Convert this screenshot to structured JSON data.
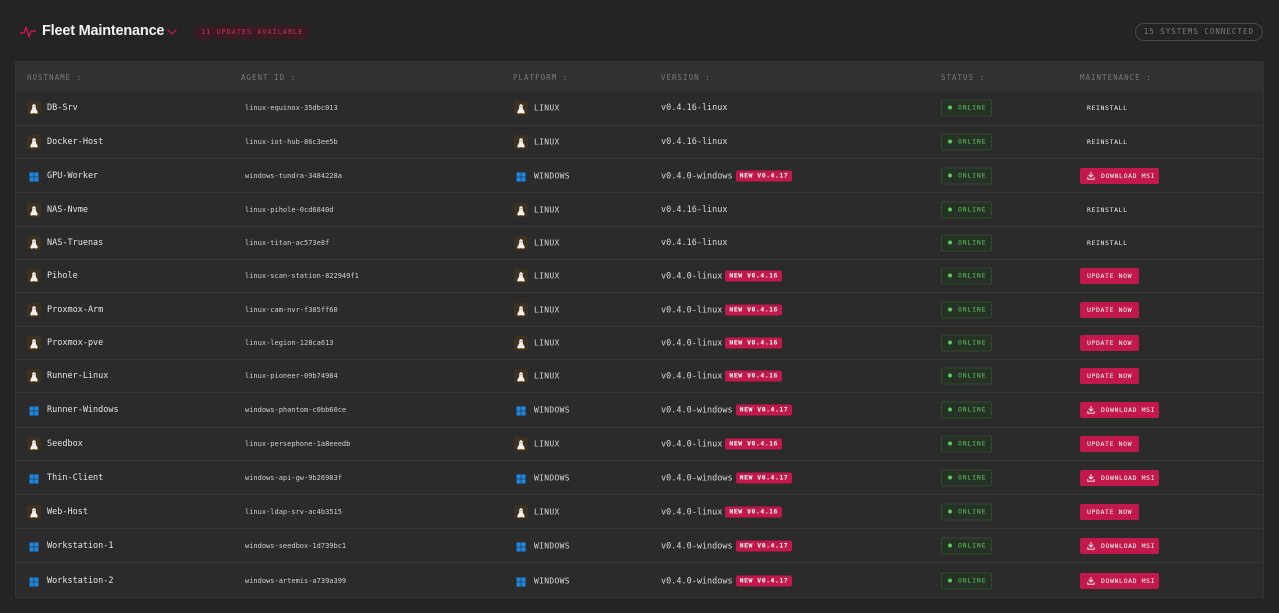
{
  "header": {
    "title": "Fleet Maintenance",
    "updates_badge": "11 UPDATES AVAILABLE",
    "systems_badge": "15 SYSTEMS CONNECTED"
  },
  "columns": {
    "hostname": "HOSTNAME",
    "agent_id": "AGENT ID",
    "platform": "PLATFORM",
    "version": "VERSION",
    "status": "STATUS",
    "maintenance": "MAINTENANCE"
  },
  "colors": {
    "accent": "#c2184b",
    "online": "#5bc45b",
    "background": "#242424"
  },
  "rows": [
    {
      "hostname": "DB-Srv",
      "agent_id": "linux-equinox-35dbc013",
      "os": "linux",
      "platform": "LINUX",
      "version": "v0.4.16-linux",
      "new_version": "",
      "status": "ONLINE",
      "action": "REINSTALL",
      "action_type": "reinstall"
    },
    {
      "hostname": "Docker-Host",
      "agent_id": "linux-iot-hub-86c3ee5b",
      "os": "linux",
      "platform": "LINUX",
      "version": "v0.4.16-linux",
      "new_version": "",
      "status": "ONLINE",
      "action": "REINSTALL",
      "action_type": "reinstall"
    },
    {
      "hostname": "GPU-Worker",
      "agent_id": "windows-tundra-3484228a",
      "os": "windows",
      "platform": "WINDOWS",
      "version": "v0.4.0-windows",
      "new_version": "NEW V0.4.17",
      "status": "ONLINE",
      "action": "DOWNLOAD MSI",
      "action_type": "msi"
    },
    {
      "hostname": "NAS-Nvme",
      "agent_id": "linux-pihole-0cd6840d",
      "os": "linux",
      "platform": "LINUX",
      "version": "v0.4.16-linux",
      "new_version": "",
      "status": "ONLINE",
      "action": "REINSTALL",
      "action_type": "reinstall"
    },
    {
      "hostname": "NAS-Truenas",
      "agent_id": "linux-titan-ac573e8f",
      "os": "linux",
      "platform": "LINUX",
      "version": "v0.4.16-linux",
      "new_version": "",
      "status": "ONLINE",
      "action": "REINSTALL",
      "action_type": "reinstall"
    },
    {
      "hostname": "Pihole",
      "agent_id": "linux-scan-station-822949f1",
      "os": "linux",
      "platform": "LINUX",
      "version": "v0.4.0-linux",
      "new_version": "NEW V0.4.16",
      "status": "ONLINE",
      "action": "UPDATE NOW",
      "action_type": "update"
    },
    {
      "hostname": "Proxmox-Arm",
      "agent_id": "linux-cam-nvr-f385ff60",
      "os": "linux",
      "platform": "LINUX",
      "version": "v0.4.0-linux",
      "new_version": "NEW V0.4.16",
      "status": "ONLINE",
      "action": "UPDATE NOW",
      "action_type": "update"
    },
    {
      "hostname": "Proxmox-pve",
      "agent_id": "linux-legion-128ca613",
      "os": "linux",
      "platform": "LINUX",
      "version": "v0.4.0-linux",
      "new_version": "NEW V0.4.16",
      "status": "ONLINE",
      "action": "UPDATE NOW",
      "action_type": "update"
    },
    {
      "hostname": "Runner-Linux",
      "agent_id": "linux-pioneer-09b74984",
      "os": "linux",
      "platform": "LINUX",
      "version": "v0.4.0-linux",
      "new_version": "NEW V0.4.16",
      "status": "ONLINE",
      "action": "UPDATE NOW",
      "action_type": "update"
    },
    {
      "hostname": "Runner-Windows",
      "agent_id": "windows-phantom-c0bb60ce",
      "os": "windows",
      "platform": "WINDOWS",
      "version": "v0.4.0-windows",
      "new_version": "NEW V0.4.17",
      "status": "ONLINE",
      "action": "DOWNLOAD MSI",
      "action_type": "msi"
    },
    {
      "hostname": "Seedbox",
      "agent_id": "linux-persephone-1a8eeedb",
      "os": "linux",
      "platform": "LINUX",
      "version": "v0.4.0-linux",
      "new_version": "NEW V0.4.16",
      "status": "ONLINE",
      "action": "UPDATE NOW",
      "action_type": "update"
    },
    {
      "hostname": "Thin-Client",
      "agent_id": "windows-api-gw-9b26983f",
      "os": "windows",
      "platform": "WINDOWS",
      "version": "v0.4.0-windows",
      "new_version": "NEW V0.4.17",
      "status": "ONLINE",
      "action": "DOWNLOAD MSI",
      "action_type": "msi"
    },
    {
      "hostname": "Web-Host",
      "agent_id": "linux-ldap-srv-ac4b3515",
      "os": "linux",
      "platform": "LINUX",
      "version": "v0.4.0-linux",
      "new_version": "NEW V0.4.16",
      "status": "ONLINE",
      "action": "UPDATE NOW",
      "action_type": "update"
    },
    {
      "hostname": "Workstation-1",
      "agent_id": "windows-seedbox-1d739bc1",
      "os": "windows",
      "platform": "WINDOWS",
      "version": "v0.4.0-windows",
      "new_version": "NEW V0.4.17",
      "status": "ONLINE",
      "action": "DOWNLOAD MSI",
      "action_type": "msi"
    },
    {
      "hostname": "Workstation-2",
      "agent_id": "windows-artemis-a739a399",
      "os": "windows",
      "platform": "WINDOWS",
      "version": "v0.4.0-windows",
      "new_version": "NEW V0.4.17",
      "status": "ONLINE",
      "action": "DOWNLOAD MSI",
      "action_type": "msi"
    }
  ]
}
